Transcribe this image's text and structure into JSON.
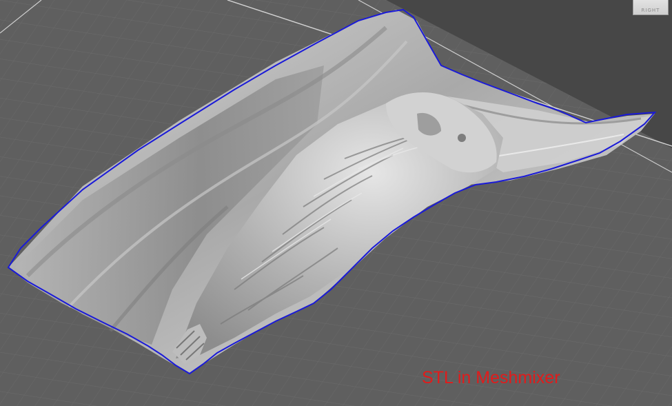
{
  "viewport": {
    "background_color": "#5f5f5f",
    "grid_color": "#6e6e6e",
    "floor_edge_color": "#d9d9d9",
    "far_plane_color": "#474747",
    "selection_outline_color": "#1a1ad8"
  },
  "view_cube": {
    "face_label": "RIGHT"
  },
  "model": {
    "subject": "eagle relief mesh"
  },
  "caption": {
    "text": "STL in Meshmixer",
    "color": "#e21b1b"
  }
}
